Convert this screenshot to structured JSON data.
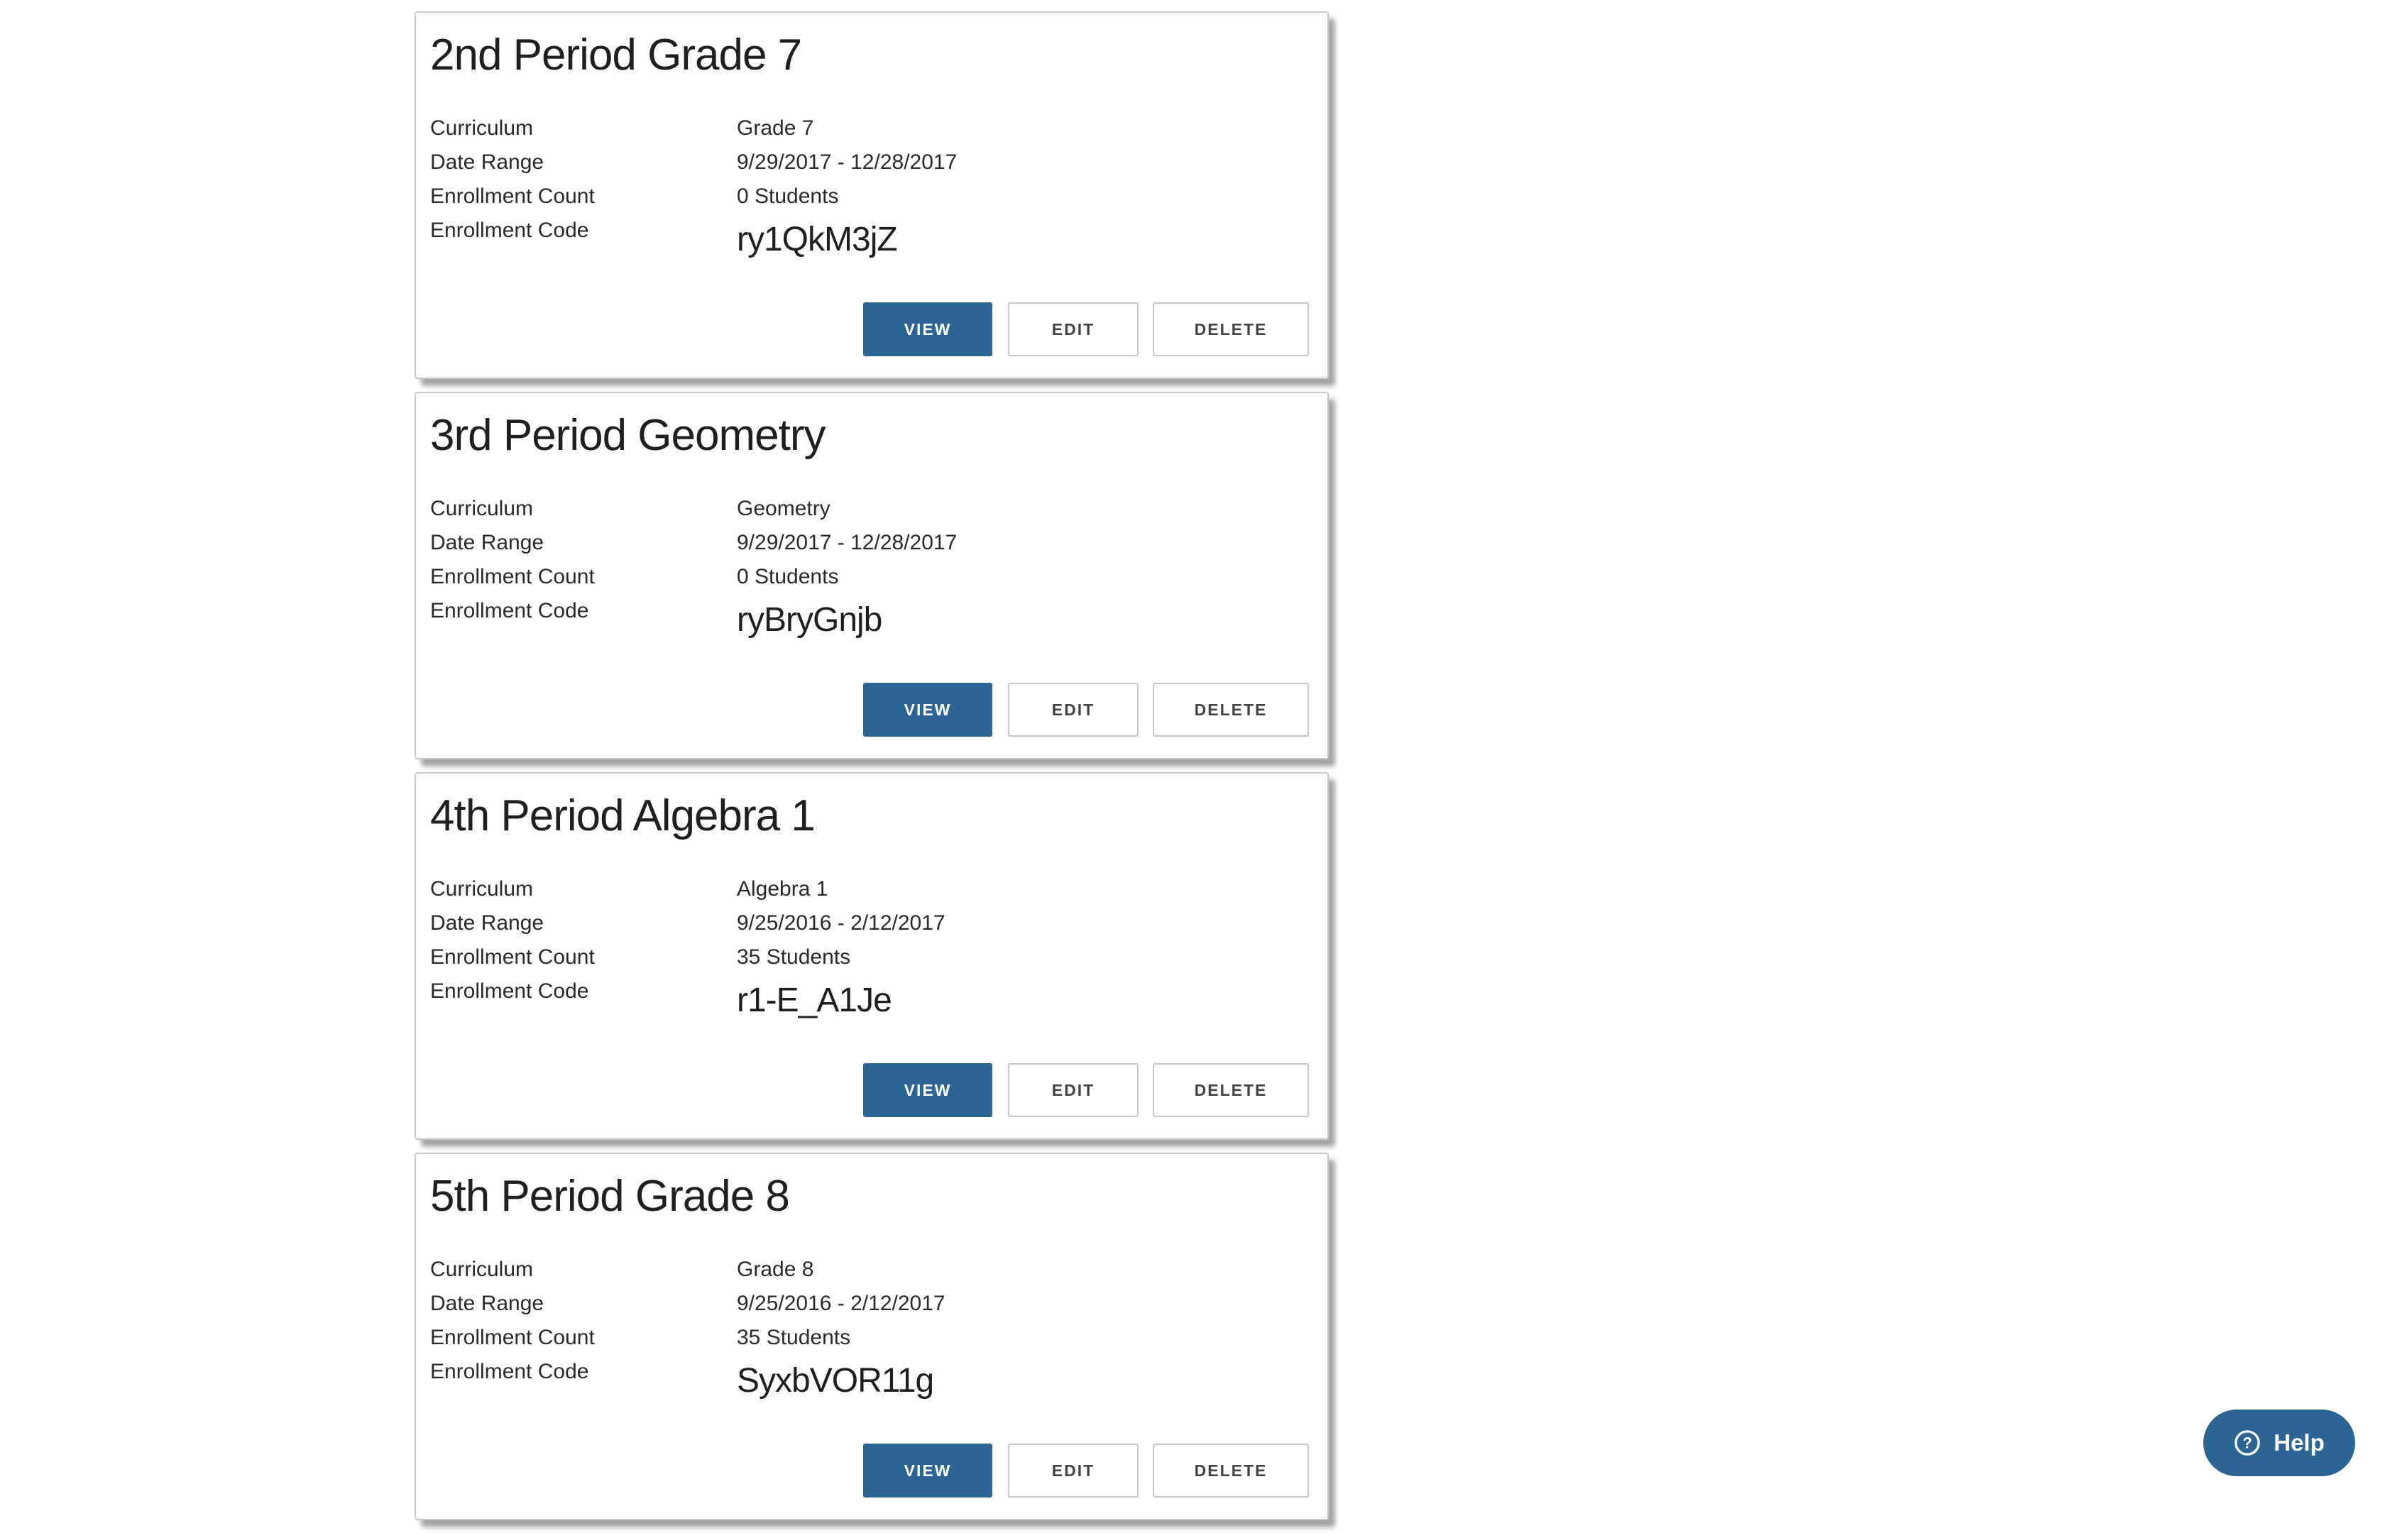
{
  "classes": [
    {
      "title": "2nd Period Grade 7",
      "labels": {
        "curriculum": "Curriculum",
        "date_range": "Date Range",
        "enrollment_count": "Enrollment Count",
        "enrollment_code": "Enrollment Code"
      },
      "curriculum": "Grade 7",
      "date_range": "9/29/2017 - 12/28/2017",
      "enrollment_count": "0 Students",
      "enrollment_code": "ry1QkM3jZ",
      "buttons": {
        "view": "VIEW",
        "edit": "EDIT",
        "delete": "DELETE"
      }
    },
    {
      "title": "3rd Period Geometry",
      "labels": {
        "curriculum": "Curriculum",
        "date_range": "Date Range",
        "enrollment_count": "Enrollment Count",
        "enrollment_code": "Enrollment Code"
      },
      "curriculum": "Geometry",
      "date_range": "9/29/2017 - 12/28/2017",
      "enrollment_count": "0 Students",
      "enrollment_code": "ryBryGnjb",
      "buttons": {
        "view": "VIEW",
        "edit": "EDIT",
        "delete": "DELETE"
      }
    },
    {
      "title": "4th Period Algebra 1",
      "labels": {
        "curriculum": "Curriculum",
        "date_range": "Date Range",
        "enrollment_count": "Enrollment Count",
        "enrollment_code": "Enrollment Code"
      },
      "curriculum": "Algebra 1",
      "date_range": "9/25/2016 - 2/12/2017",
      "enrollment_count": "35 Students",
      "enrollment_code": "r1-E_A1Je",
      "buttons": {
        "view": "VIEW",
        "edit": "EDIT",
        "delete": "DELETE"
      }
    },
    {
      "title": "5th Period Grade 8",
      "labels": {
        "curriculum": "Curriculum",
        "date_range": "Date Range",
        "enrollment_count": "Enrollment Count",
        "enrollment_code": "Enrollment Code"
      },
      "curriculum": "Grade 8",
      "date_range": "9/25/2016 - 2/12/2017",
      "enrollment_count": "35 Students",
      "enrollment_code": "SyxbVOR11g",
      "buttons": {
        "view": "VIEW",
        "edit": "EDIT",
        "delete": "DELETE"
      }
    }
  ],
  "help": {
    "label": "Help",
    "icon": "question-circle-icon"
  },
  "colors": {
    "primary": "#2a6594",
    "card_border": "#c9c9c9",
    "text": "#222222",
    "background": "#ffffff"
  }
}
